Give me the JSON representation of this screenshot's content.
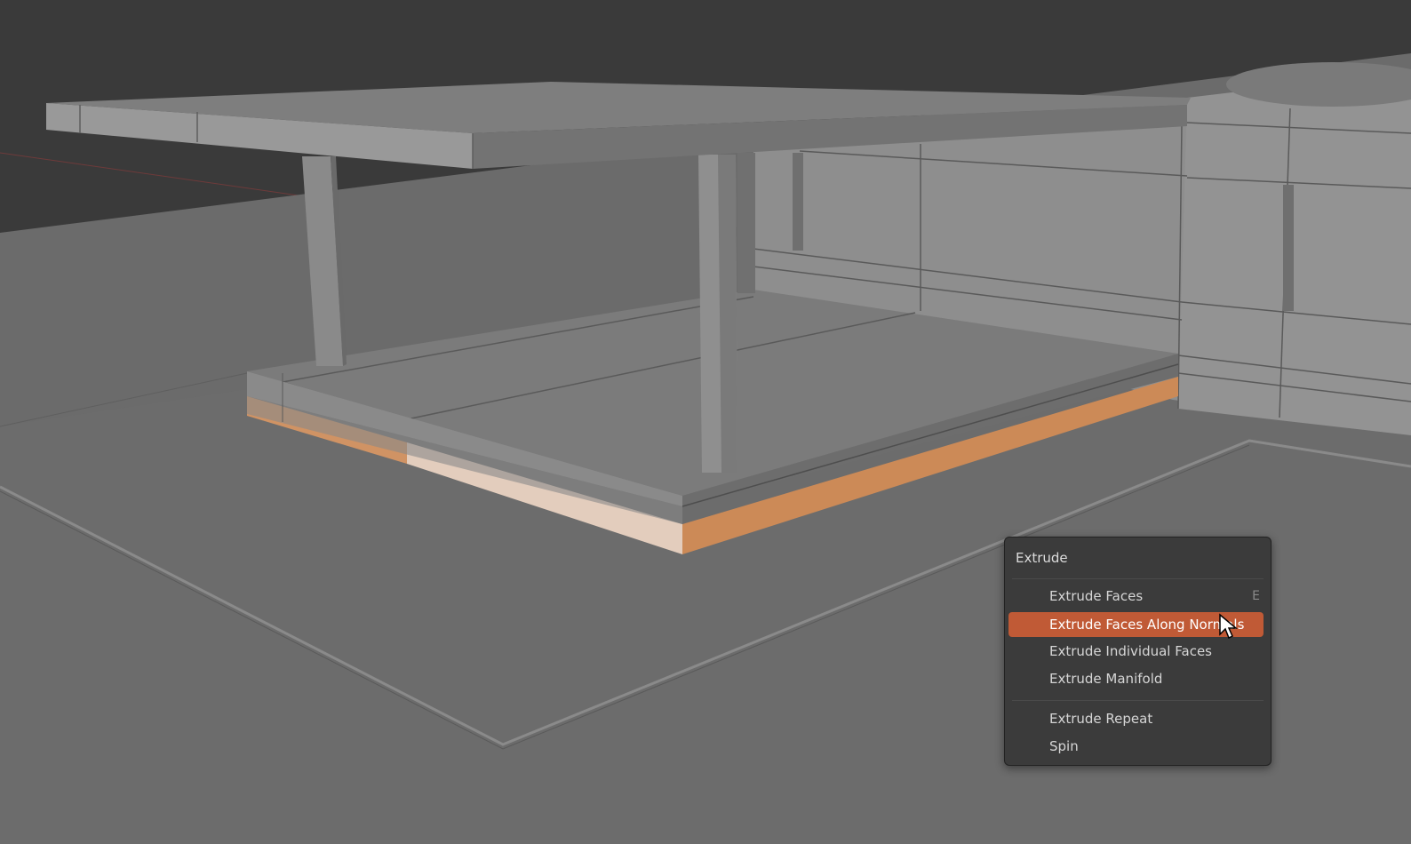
{
  "viewport": {
    "background_color": "#3a3a3a",
    "ground_color": "#6b6b6b",
    "model_color": "#8c8c8c",
    "selection_color": "#d89a6a"
  },
  "extrude_menu": {
    "title": "Extrude",
    "items": [
      {
        "label": "Extrude Faces",
        "shortcut": "E"
      },
      {
        "label": "Extrude Faces Along Normals",
        "shortcut": ""
      },
      {
        "label": "Extrude Individual Faces",
        "shortcut": ""
      },
      {
        "label": "Extrude Manifold",
        "shortcut": ""
      },
      {
        "label": "Extrude Repeat",
        "shortcut": ""
      },
      {
        "label": "Spin",
        "shortcut": ""
      }
    ],
    "highlight_color": "#c05a36"
  },
  "cursor": {
    "icon": "arrow-pointer-icon"
  }
}
